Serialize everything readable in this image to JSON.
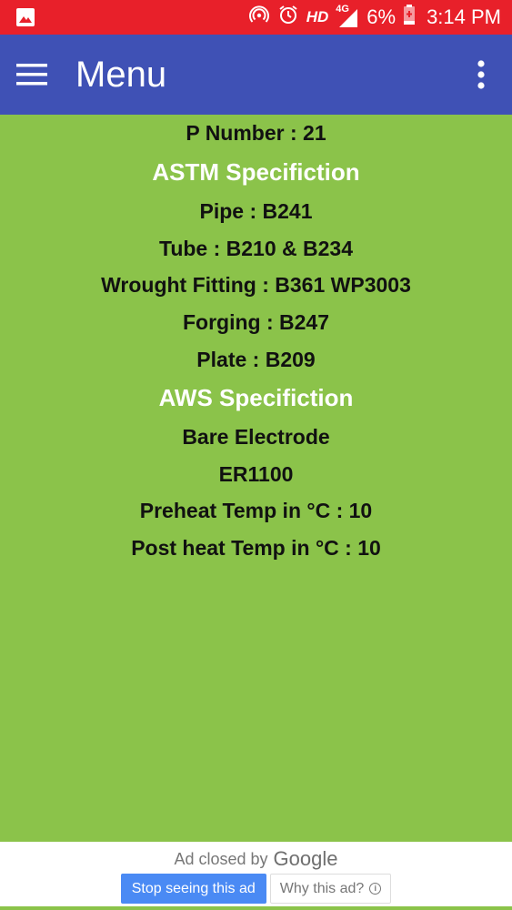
{
  "status_bar": {
    "network_label": "HD",
    "signal_label": "4G",
    "battery_percent": "6%",
    "time": "3:14 PM",
    "background_color": "#e8202a",
    "icons": [
      "image-icon",
      "hotspot-icon",
      "alarm-icon",
      "signal-icon",
      "battery-icon"
    ]
  },
  "app_bar": {
    "title": "Menu",
    "background_color": "#3f51b5",
    "icons": [
      "hamburger-menu-icon",
      "overflow-menu-icon"
    ]
  },
  "content": {
    "background_color": "#8bc34a",
    "p_number": "P Number : 21",
    "astm_heading": "ASTM Specifiction",
    "pipe": "Pipe : B241",
    "tube": "Tube : B210 & B234",
    "wrought_fitting": "Wrought Fitting : B361 WP3003",
    "forging": "Forging : B247",
    "plate": "Plate : B209",
    "aws_heading": "AWS Specifiction",
    "bare_electrode": "Bare Electrode",
    "electrode_code": "ER1100",
    "preheat": "Preheat Temp in °C : 10",
    "postheat": "Post heat Temp in °C : 10"
  },
  "ad": {
    "closed_text": "Ad closed by",
    "google_text": "Google",
    "stop_label": "Stop seeing this ad",
    "why_label": "Why this ad?",
    "info_glyph": "i",
    "stop_button_color": "#4a8af4"
  }
}
